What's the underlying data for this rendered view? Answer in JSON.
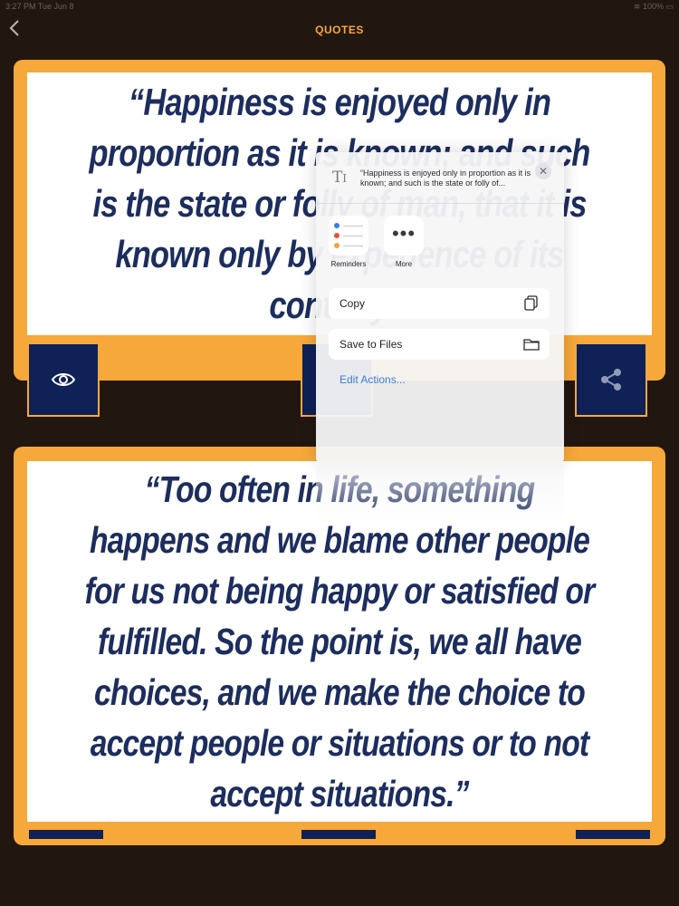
{
  "status_bar": {
    "time": "3:27 PM",
    "date": "Tue Jun 8",
    "battery": "100%"
  },
  "nav": {
    "title": "QUOTES",
    "back_icon": "chevron-left-icon"
  },
  "quotes": [
    {
      "text": "“Happiness is enjoyed only in proportion as it is known; and such is the state or folly of man, that it is known only by experience of its contrary.”"
    },
    {
      "text": "“Too often in life, something happens and we blame other people for us not being happy or satisfied or fulfilled. So the point is, we all have choices, and we make the choice to accept people or situations or to not accept situations.”"
    }
  ],
  "share_sheet": {
    "preview": "“Happiness is enjoyed only in proportion as it is known; and such is the state or folly of...",
    "apps": [
      {
        "label": "Reminders",
        "icon": "reminders-icon"
      },
      {
        "label": "More",
        "icon": "more-icon"
      }
    ],
    "actions": [
      {
        "label": "Copy",
        "icon": "copy-icon"
      },
      {
        "label": "Save to Files",
        "icon": "folder-icon"
      }
    ],
    "edit_actions": "Edit Actions..."
  },
  "colors": {
    "background": "#221611",
    "accent": "#f6a83a",
    "quote_text": "#1c2d5e",
    "button": "#0f2157",
    "link": "#3b7cdd"
  }
}
